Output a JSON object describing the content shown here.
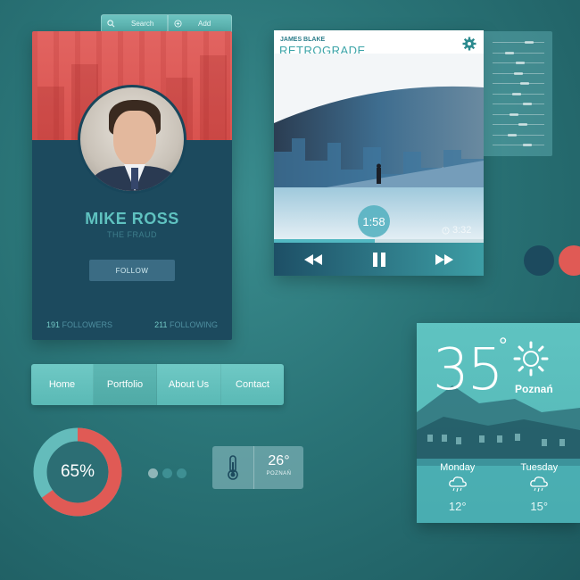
{
  "top_tabs": {
    "search_label": "Search",
    "add_label": "Add"
  },
  "profile": {
    "name": "MIKE ROSS",
    "subtitle": "THE FRAUD",
    "follow_label": "FOLLOW",
    "followers_count": "191",
    "followers_label": "FOLLOWERS",
    "following_count": "211",
    "following_label": "FOLLOWING"
  },
  "player": {
    "artist": "JAMES BLAKE",
    "track": "RETROGRADE",
    "current_time": "1:58",
    "remaining_time": "3:32",
    "progress": 0.48,
    "controls": {
      "prev": "rewind-icon",
      "pause": "pause-icon",
      "next": "fast-forward-icon"
    }
  },
  "equalizer": {
    "levels": [
      0.75,
      0.3,
      0.55,
      0.5,
      0.65,
      0.45,
      0.7,
      0.4,
      0.6,
      0.35,
      0.7
    ]
  },
  "swatches": [
    "#1c4a5e",
    "#e05a55"
  ],
  "nav": {
    "items": [
      {
        "label": "Home",
        "active": false
      },
      {
        "label": "Portfolio",
        "active": true
      },
      {
        "label": "About Us",
        "active": false
      },
      {
        "label": "Contact",
        "active": false
      }
    ]
  },
  "donut": {
    "percent_text": "65%",
    "value": 0.65,
    "colors": {
      "track": "#64bcbb",
      "fill": "#e05a55"
    }
  },
  "pager": {
    "count": 3,
    "active": 0
  },
  "temp_widget": {
    "value": "26°",
    "city": "POZNAŃ"
  },
  "weather": {
    "temperature": "35",
    "degree_symbol": "°",
    "city": "Poznań",
    "icon": "sun-icon",
    "days": [
      {
        "name": "Monday",
        "temp": "12°",
        "icon": "rain-cloud-icon"
      },
      {
        "name": "Tuesday",
        "temp": "15°",
        "icon": "rain-cloud-icon"
      }
    ]
  },
  "colors": {
    "accent": "#5fc2c0",
    "coral": "#e05a55",
    "navy": "#1c4a5e"
  }
}
